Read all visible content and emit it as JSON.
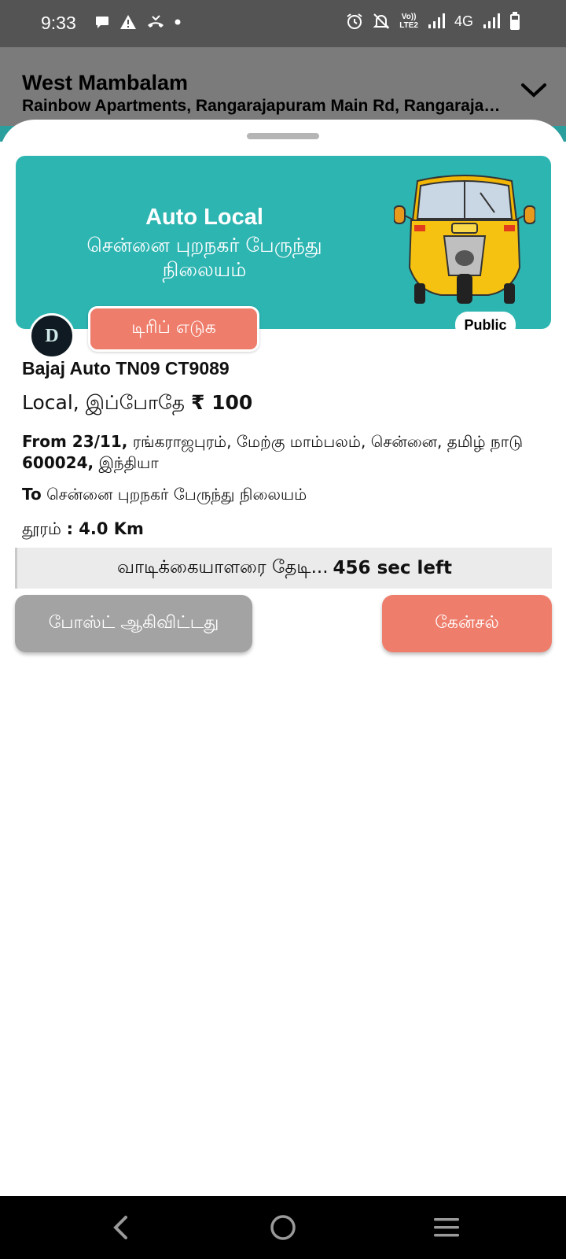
{
  "status_bar": {
    "time": "9:33",
    "volte_label_1": "Vo))",
    "volte_label_2": "LTE2",
    "network": "4G",
    "icons": [
      "chat-bubble-icon",
      "warning-icon",
      "missed-call-icon",
      "dot-icon",
      "alarm-icon",
      "bell-off-icon",
      "signal-icon",
      "battery-icon"
    ]
  },
  "location": {
    "title": "West Mambalam",
    "subtitle": "Rainbow Apartments, Rangarajapuram Main Rd, Rangarajapuram, West Mambalam"
  },
  "banner": {
    "title": "Auto Local",
    "subtitle": "சென்னை புறநகர் பேருந்து நிலையம்",
    "background": "#2db5b2",
    "image": "auto-rickshaw-icon"
  },
  "avatar_letter": "D",
  "trip_button": "டிரிப் எடுக",
  "badge": "Public",
  "vehicle": "Bajaj Auto TN09 CT9089",
  "fare": {
    "label": "Local, இப்போதே",
    "amount": "₹ 100"
  },
  "from": {
    "label": "From 23/11,",
    "address": "ரங்கராஜபுரம், மேற்கு மாம்பலம், சென்னை, தமிழ் நாடு",
    "pin": "600024,",
    "country": "இந்தியா"
  },
  "to": {
    "label": "To",
    "address": "சென்னை புறநகர் பேருந்து நிலையம்"
  },
  "distance": {
    "label": "தூரம்",
    "value": ": 4.0 Km"
  },
  "search_status": {
    "text": "வாடிக்கையாளரை தேடி...",
    "countdown": "456 sec left"
  },
  "buttons": {
    "posted": "போஸ்ட் ஆகிவிட்டது",
    "cancel": "கேன்சல்"
  },
  "colors": {
    "accent": "#ef7d6b",
    "teal": "#2db5b2",
    "disabled": "#a3a3a3"
  }
}
